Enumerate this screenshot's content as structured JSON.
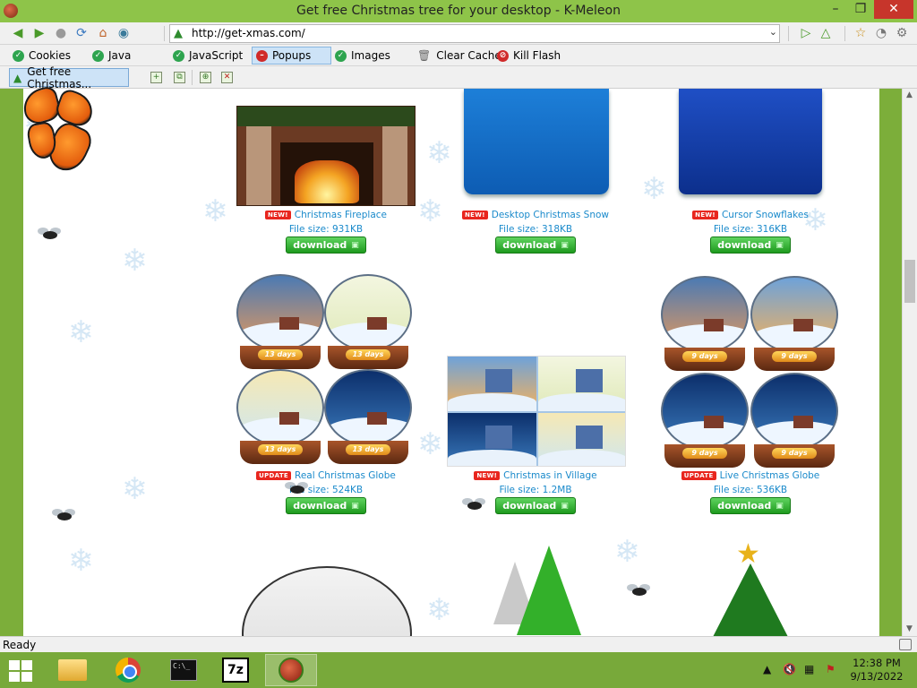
{
  "window": {
    "title": "Get free Christmas tree for your desktop - K-Meleon",
    "minimize": "–",
    "maximize": "❐",
    "close": "✕"
  },
  "navbar": {
    "url": "http://get-xmas.com/"
  },
  "privacy_bar": {
    "items": [
      {
        "label": "Cookies",
        "state": "on"
      },
      {
        "label": "Java",
        "state": "on"
      },
      {
        "label": "JavaScript",
        "state": "on"
      },
      {
        "label": "Popups",
        "state": "blocked"
      },
      {
        "label": "Images",
        "state": "on"
      }
    ],
    "clear_cache": "Clear Cache",
    "kill_flash": "Kill Flash"
  },
  "tabs": [
    {
      "label": "Get free Christmas...",
      "active": true
    }
  ],
  "products": [
    {
      "name": "Christmas Fireplace",
      "badge": "NEW!",
      "size": "File size: 931KB",
      "button": "download"
    },
    {
      "name": "Desktop Christmas Snow",
      "badge": "NEW!",
      "size": "File size: 318KB",
      "button": "download"
    },
    {
      "name": "Cursor Snowflakes",
      "badge": "NEW!",
      "size": "File size: 316KB",
      "button": "download"
    },
    {
      "name": "Real Christmas Globe",
      "badge": "UPDATE",
      "size": "File size: 524KB",
      "button": "download"
    },
    {
      "name": "Christmas in Village",
      "badge": "NEW!",
      "size": "File size: 1.2MB",
      "button": "download"
    },
    {
      "name": "Live Christmas Globe",
      "badge": "UPDATE",
      "size": "File size: 536KB",
      "button": "download"
    }
  ],
  "globe_days": {
    "real": "13 days",
    "live": "9 days"
  },
  "status": {
    "text": "Ready"
  },
  "taskbar": {
    "apps": [
      "file-explorer",
      "chrome",
      "command-prompt",
      "7-zip",
      "k-meleon"
    ],
    "time": "12:38 PM",
    "date": "9/13/2022"
  },
  "colors": {
    "title_bar": "#8ec449",
    "taskbar": "#78a93a",
    "link": "#1a8acb",
    "download_button": "#1e9a1e",
    "badge": "#e8261e"
  }
}
